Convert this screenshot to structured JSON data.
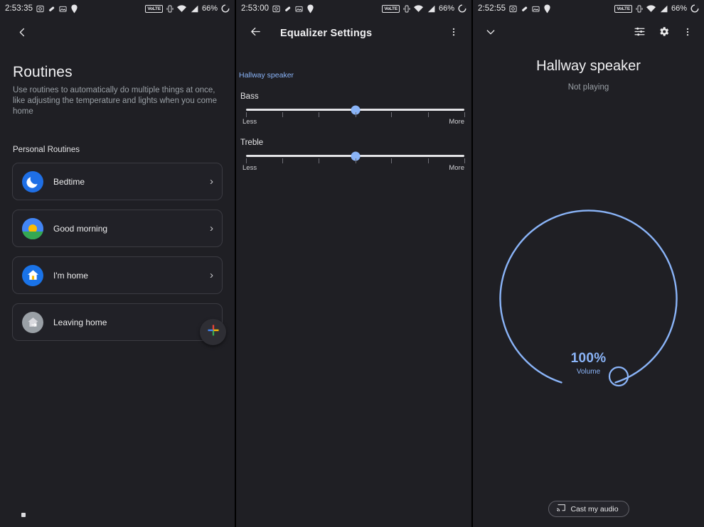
{
  "colors": {
    "bg": "#1f1f24",
    "card_bg": "#212127",
    "card_border": "#3b3b42",
    "accent_blue": "#8ab4f8",
    "text_primary": "#f1f1f3",
    "text_secondary": "#9aa0a6",
    "track": "#e3e3e6"
  },
  "left": {
    "statusbar": {
      "time": "2:53:35",
      "left_icons": [
        "screenshot-icon",
        "pill-icon",
        "photo-icon",
        "location-pin-icon"
      ],
      "network_badge": "VoLTE",
      "right_icons": [
        "vibrate-icon",
        "wifi-icon",
        "signal-icon"
      ],
      "battery_percent": "66%"
    },
    "back_icon": "chevron-left-icon",
    "title": "Routines",
    "description": "Use routines to automatically do multiple things at once, like adjusting the temperature and lights when you come home",
    "section_label": "Personal Routines",
    "routines": [
      {
        "label": "Bedtime",
        "icon": "moon-icon",
        "chevron": "›"
      },
      {
        "label": "Good morning",
        "icon": "sunrise-icon",
        "chevron": "›"
      },
      {
        "label": "I'm home",
        "icon": "house-icon",
        "chevron": "›"
      },
      {
        "label": "Leaving home",
        "icon": "house-exit-icon",
        "chevron": "›"
      }
    ],
    "fab": {
      "icon": "plus-icon",
      "label": "Add routine"
    }
  },
  "middle": {
    "statusbar": {
      "time": "2:53:00",
      "network_badge": "VoLTE",
      "battery_percent": "66%"
    },
    "back_icon": "arrow-left-icon",
    "title": "Equalizer Settings",
    "overflow_icon": "more-vertical-icon",
    "device_name": "Hallway speaker",
    "sliders": [
      {
        "label": "Bass",
        "value": 50,
        "min_label": "Less",
        "max_label": "More",
        "tick_count": 7
      },
      {
        "label": "Treble",
        "value": 50,
        "min_label": "Less",
        "max_label": "More",
        "tick_count": 7
      }
    ]
  },
  "right": {
    "statusbar": {
      "time": "2:52:55",
      "network_badge": "VoLTE",
      "battery_percent": "66%"
    },
    "collapse_icon": "chevron-down-icon",
    "actions": [
      {
        "icon": "tune-icon",
        "label": "Equalizer"
      },
      {
        "icon": "gear-icon",
        "label": "Settings"
      },
      {
        "icon": "more-vertical-icon",
        "label": "More options"
      }
    ],
    "device_title": "Hallway speaker",
    "playback_status": "Not playing",
    "volume": {
      "percent_label": "100%",
      "caption": "Volume",
      "value": 100
    },
    "cast_button": {
      "icon": "cast-icon",
      "label": "Cast my audio"
    }
  }
}
